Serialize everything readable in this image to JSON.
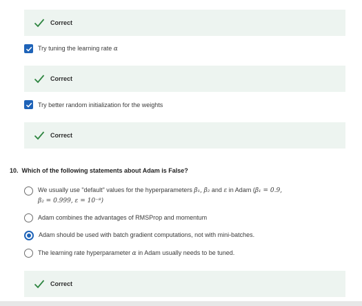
{
  "feedback_label": "Correct",
  "colors": {
    "accent": "#1e63b8",
    "success": "#2e8540",
    "feedback_bg": "#edf4f0"
  },
  "options": [
    {
      "label": "Try tuning the learning rate",
      "math": "α",
      "checked": true
    },
    {
      "label": "Try better random initialization for the weights",
      "checked": true
    }
  ],
  "question": {
    "number": "10.",
    "text": "Which of the following statements about Adam is False?",
    "answers": [
      {
        "line1": "We usually use \"default\" values for the hyperparameters",
        "b1": "β₁",
        "comma": ",",
        "b2": "β₂",
        "and": "and",
        "eps": "ε",
        "in": "in Adam (",
        "eq1": "β₁ = 0.9,",
        "line2": "β₂ = 0.999, ε = 10⁻⁸)",
        "selected": false
      },
      {
        "text": "Adam combines the advantages of RMSProp and momentum",
        "selected": false
      },
      {
        "text": "Adam should be used with batch gradient computations, not with mini-batches.",
        "selected": true
      },
      {
        "text_before": "The learning rate hyperparameter",
        "math": "α",
        "text_after": "in Adam usually needs to be tuned.",
        "selected": false
      }
    ]
  },
  "icons": {
    "feedback": "checkmark-icon",
    "checkbox": "checkbox-checked-icon"
  }
}
